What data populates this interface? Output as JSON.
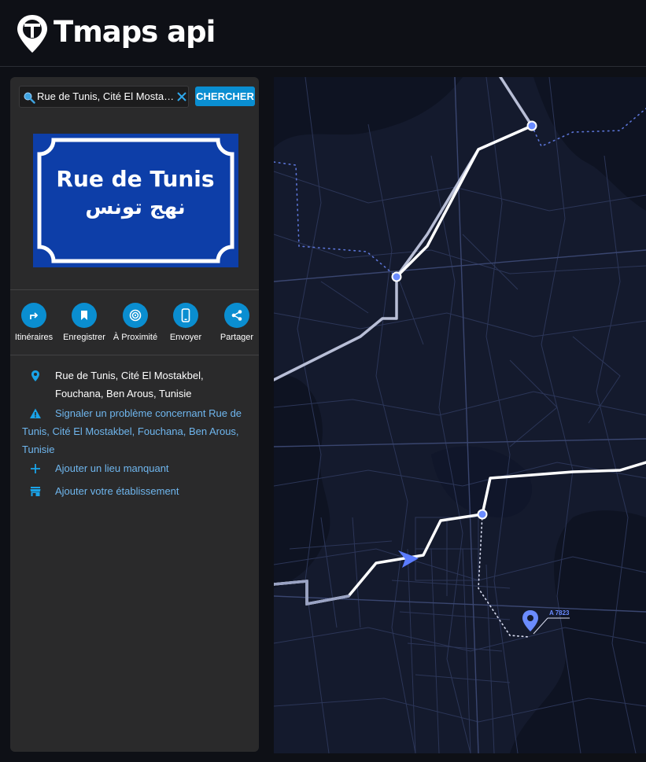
{
  "app": {
    "brand": "Tmaps api"
  },
  "search": {
    "value": "Rue de Tunis, Cité El Mostak...",
    "button_label": "CHERCHER"
  },
  "sign": {
    "title_fr": "Rue de Tunis",
    "title_ar": "نهج تونس",
    "background_color": "#0d3ea8"
  },
  "actions": [
    {
      "label": "Itinéraires",
      "icon": "directions-icon"
    },
    {
      "label": "Enregistrer",
      "icon": "bookmark-icon"
    },
    {
      "label": "À Proximité",
      "icon": "nearby-icon"
    },
    {
      "label": "Envoyer",
      "icon": "phone-icon"
    },
    {
      "label": "Partager",
      "icon": "share-icon"
    }
  ],
  "info": {
    "address": "Rue de Tunis, Cité El Mostakbel, Fouchana, Ben Arous, Tunisie",
    "report": "Signaler un problème concernant Rue de Tunis, Cité El Mostakbel, Fouchana, Ben Arous, Tunisie",
    "add_place": "Ajouter un lieu manquant",
    "add_business": "Ajouter votre établissement"
  },
  "map": {
    "marker_label": "A 7823"
  },
  "colors": {
    "accent": "#0a8ed1",
    "link": "#6fb6ee",
    "map_background": "#141a2d",
    "route": "#ffffff",
    "marker": "#6b8cff"
  }
}
